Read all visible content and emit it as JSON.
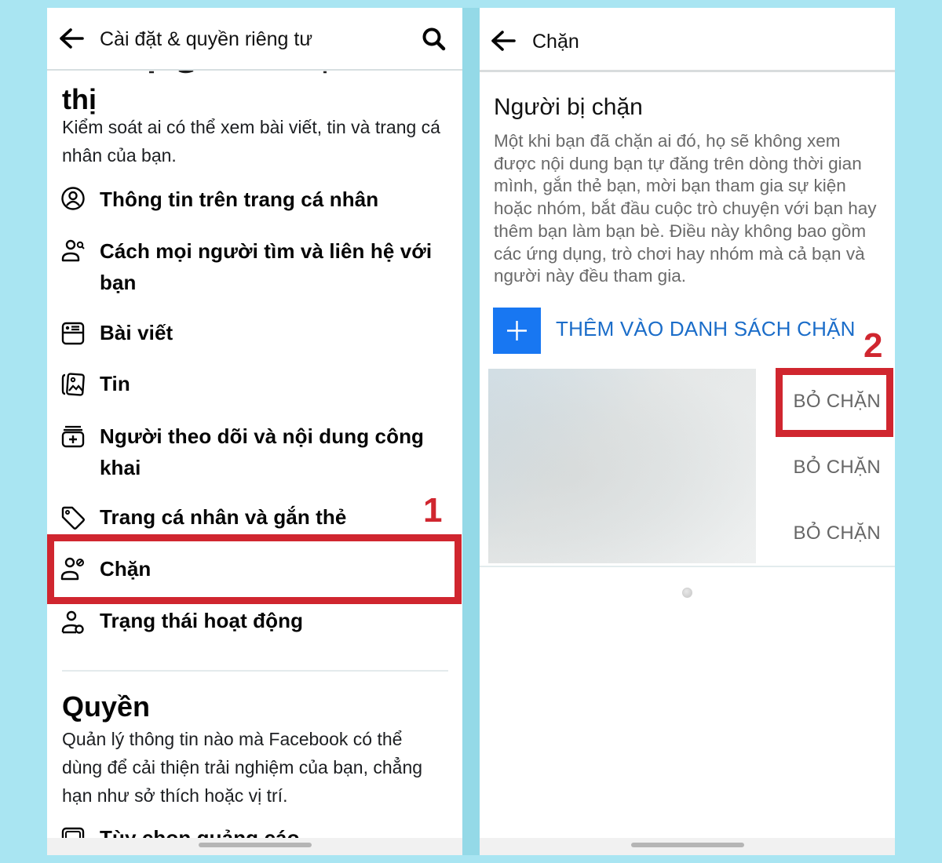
{
  "left_screen": {
    "header": {
      "title": "Cài đặt & quyền riêng tư",
      "back_icon": "arrow-left-icon",
      "search_icon": "search-icon"
    },
    "audience_section": {
      "title_fragment": "thị",
      "description": "Kiểm soát ai có thể xem bài viết, tin và trang cá nhân của bạn."
    },
    "items": [
      {
        "label": "Thông tin trên trang cá nhân",
        "icon": "profile-circle-icon"
      },
      {
        "label": "Cách mọi người tìm và liên hệ với bạn",
        "icon": "people-search-icon"
      },
      {
        "label": "Bài viết",
        "icon": "post-icon"
      },
      {
        "label": "Tin",
        "icon": "story-icon"
      },
      {
        "label": "Người theo dõi và nội dung công khai",
        "icon": "followers-icon"
      },
      {
        "label": "Trang cá nhân và gắn thẻ",
        "icon": "tag-icon"
      },
      {
        "label": "Chặn",
        "icon": "block-user-icon"
      },
      {
        "label": "Trạng thái hoạt động",
        "icon": "active-status-icon"
      }
    ],
    "permissions_section": {
      "title": "Quyền",
      "description": "Quản lý thông tin nào mà Facebook có thể dùng để cải thiện trải nghiệm của bạn, chẳng hạn như sở thích hoặc vị trí.",
      "partial_item": "Tùy chọn quảng cáo"
    },
    "annotation": {
      "number": "1",
      "target": "Chặn",
      "color": "#d0262f"
    }
  },
  "right_screen": {
    "header": {
      "title": "Chặn",
      "back_icon": "arrow-left-icon"
    },
    "blocked_section": {
      "title": "Người bị chặn",
      "description": "Một khi bạn đã chặn ai đó, họ sẽ không xem được nội dung bạn tự đăng trên dòng thời gian mình, gắn thẻ bạn, mời bạn tham gia sự kiện hoặc nhóm, bắt đầu cuộc trò chuyện với bạn hay thêm bạn làm bạn bè. Điều này không bao gồm các ứng dụng, trò chơi hay nhóm mà cả bạn và người này đều tham gia."
    },
    "add_button": {
      "label": "THÊM VÀO DANH SÁCH CHẶN",
      "icon": "plus-icon",
      "color": "#1877f2"
    },
    "blocked_users": [
      {
        "action": "BỎ CHẶN"
      },
      {
        "action": "BỎ CHẶN"
      },
      {
        "action": "BỎ CHẶN"
      }
    ],
    "annotation": {
      "number": "2",
      "target": "BỎ CHẶN",
      "color": "#d0262f"
    }
  }
}
